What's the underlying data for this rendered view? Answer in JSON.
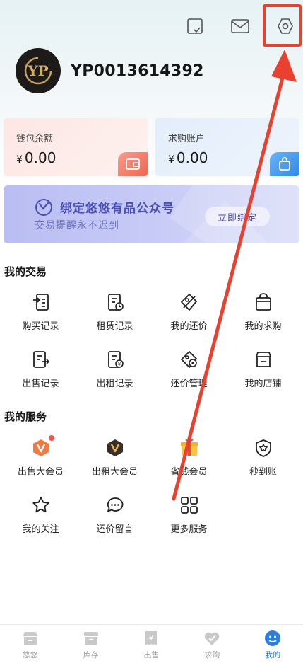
{
  "header": {
    "icons": [
      "checklist-icon",
      "mail-icon",
      "settings-icon"
    ]
  },
  "profile": {
    "user_id": "YP0013614392"
  },
  "cards": {
    "wallet": {
      "label": "钱包余额",
      "currency": "¥",
      "value": "0.00"
    },
    "purchase": {
      "label": "求购账户",
      "currency": "¥",
      "value": "0.00"
    }
  },
  "banner": {
    "title": "绑定悠悠有品公众号",
    "subtitle": "交易提醒永不迟到",
    "button": "立即绑定"
  },
  "trade": {
    "title": "我的交易",
    "items": [
      {
        "label": "购买记录",
        "icon": "purchase-record-icon"
      },
      {
        "label": "租赁记录",
        "icon": "rental-record-icon"
      },
      {
        "label": "我的还价",
        "icon": "price-tag-icon"
      },
      {
        "label": "我的求购",
        "icon": "shopping-bag-icon"
      },
      {
        "label": "出售记录",
        "icon": "sell-record-icon"
      },
      {
        "label": "出租记录",
        "icon": "lease-record-icon"
      },
      {
        "label": "还价管理",
        "icon": "bargain-manage-icon"
      },
      {
        "label": "我的店铺",
        "icon": "store-icon"
      }
    ]
  },
  "services": {
    "title": "我的服务",
    "items": [
      {
        "label": "出售大会员",
        "icon": "seller-vip-icon"
      },
      {
        "label": "出租大会员",
        "icon": "lease-vip-icon"
      },
      {
        "label": "省钱会员",
        "icon": "gift-box-icon"
      },
      {
        "label": "秒到账",
        "icon": "shield-star-icon"
      },
      {
        "label": "我的关注",
        "icon": "star-icon"
      },
      {
        "label": "还价留言",
        "icon": "chat-bubble-icon"
      },
      {
        "label": "更多服务",
        "icon": "grid-icon"
      }
    ]
  },
  "tabbar": {
    "tabs": [
      {
        "label": "悠悠",
        "active": false
      },
      {
        "label": "库存",
        "active": false
      },
      {
        "label": "出售",
        "active": false
      },
      {
        "label": "求购",
        "active": false
      },
      {
        "label": "我的",
        "active": true
      }
    ]
  },
  "colors": {
    "highlight": "#e8412f",
    "accent": "#2b7fe0",
    "banner_text": "#4a4fb5"
  }
}
